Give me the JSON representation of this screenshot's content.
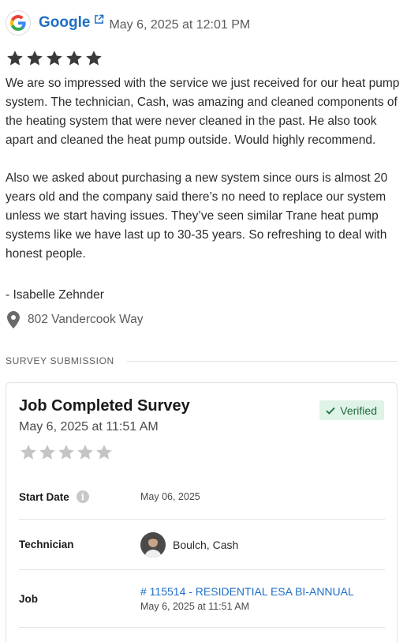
{
  "review": {
    "source": "Google",
    "source_icon": "google-logo-icon",
    "link_icon": "external-link-icon",
    "date": "May 6, 2025 at 12:01 PM",
    "rating": 5,
    "star_color": "#3a3a3a",
    "paragraphs": [
      "We are so impressed with the service we just received for our heat pump system. The technician, Cash,  was amazing and cleaned components of the heating system that were never cleaned in the past. He also took apart and cleaned the heat pump outside. Would highly recommend.",
      "Also we asked about purchasing a new system since ours is almost 20 years old and the company said there’s no need to replace our system unless we start having issues. They’ve seen similar Trane heat pump systems like we have last up to 30-35 years. So refreshing to deal with honest people."
    ],
    "reviewer": "- Isabelle Zehnder",
    "location": "802 Vandercook Way"
  },
  "section_label": "SURVEY SUBMISSION",
  "survey": {
    "title": "Job Completed Survey",
    "verified_label": "Verified",
    "verified_color": "#dff3e7",
    "date": "May 6, 2025 at 11:51 AM",
    "rating": 0,
    "empty_star_color": "#c4c4c4",
    "fields": {
      "start_date": {
        "label": "Start Date",
        "value": "May 06, 2025"
      },
      "technician": {
        "label": "Technician",
        "value": "Boulch, Cash"
      },
      "job": {
        "label": "Job",
        "link": "# 115514 - RESIDENTIAL ESA BI-ANNUAL",
        "sub": "May 6, 2025 at 11:51 AM"
      }
    }
  },
  "colors": {
    "link": "#1f6fc5"
  }
}
